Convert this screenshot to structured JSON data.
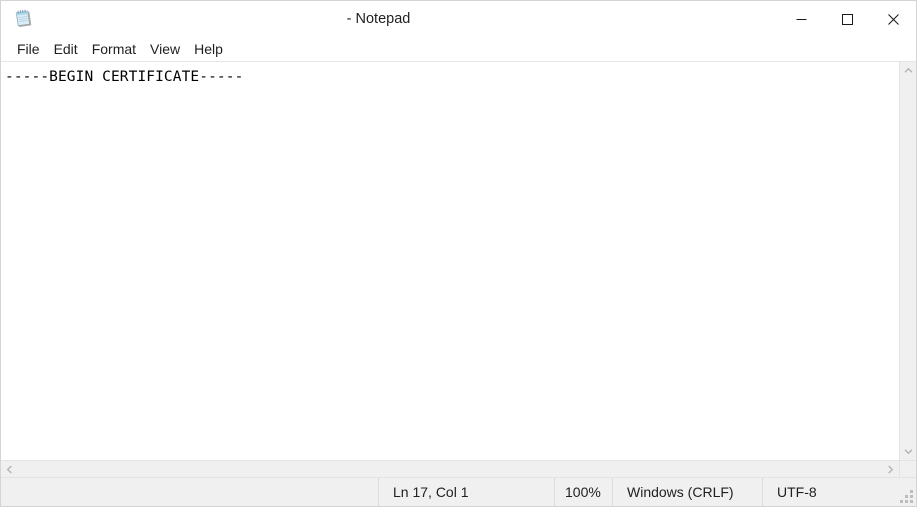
{
  "window": {
    "title": "- Notepad",
    "icon": "notepad-icon",
    "controls": {
      "minimize": "minimize-icon",
      "maximize": "maximize-icon",
      "close": "close-icon"
    }
  },
  "menubar": {
    "items": [
      {
        "label": "File"
      },
      {
        "label": "Edit"
      },
      {
        "label": "Format"
      },
      {
        "label": "View"
      },
      {
        "label": "Help"
      }
    ]
  },
  "editor": {
    "content_lines": [
      "-----BEGIN CERTIFICATE-----"
    ],
    "caret": {
      "line": 17,
      "column": 1
    }
  },
  "scrollbars": {
    "vertical": {
      "up": "chevron-up-icon",
      "down": "chevron-down-icon"
    },
    "horizontal": {
      "left": "chevron-left-icon",
      "right": "chevron-right-icon"
    }
  },
  "statusbar": {
    "position": "Ln 17, Col 1",
    "zoom": "100%",
    "line_ending": "Windows (CRLF)",
    "encoding": "UTF-8",
    "resize_grip": "resize-grip-icon"
  },
  "colors": {
    "window_bg": "#ffffff",
    "chrome_bg": "#f0f0f0",
    "text": "#1f1f1f",
    "border": "#e3e3e3",
    "scroll_arrow": "#b4b4b4",
    "close_hover": "#e81123"
  }
}
